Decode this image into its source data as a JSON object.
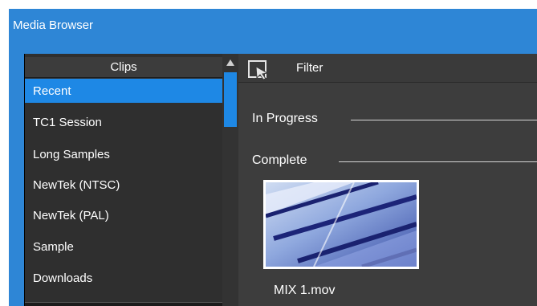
{
  "window": {
    "title": "Media Browser"
  },
  "clips": {
    "header": "Clips",
    "items": [
      {
        "label": "Recent",
        "selected": true
      },
      {
        "label": "TC1 Session",
        "selected": false
      },
      {
        "label": "Long Samples",
        "selected": false
      },
      {
        "label": "NewTek (NTSC)",
        "selected": false
      },
      {
        "label": "NewTek (PAL)",
        "selected": false
      },
      {
        "label": "Sample",
        "selected": false
      },
      {
        "label": "Downloads",
        "selected": false
      }
    ]
  },
  "scrollbar": {
    "up_icon": "triangle-up-icon"
  },
  "toolbar": {
    "filter_label": "Filter",
    "filter_icon": "cursor-select-icon"
  },
  "sections": {
    "in_progress": "In Progress",
    "complete": "Complete"
  },
  "media": [
    {
      "filename": "MIX 1.mov"
    }
  ],
  "colors": {
    "accent": "#1e88e5",
    "titlebar": "#2e86d6",
    "panel": "#2f2f2f",
    "content": "#3d3d3d"
  }
}
